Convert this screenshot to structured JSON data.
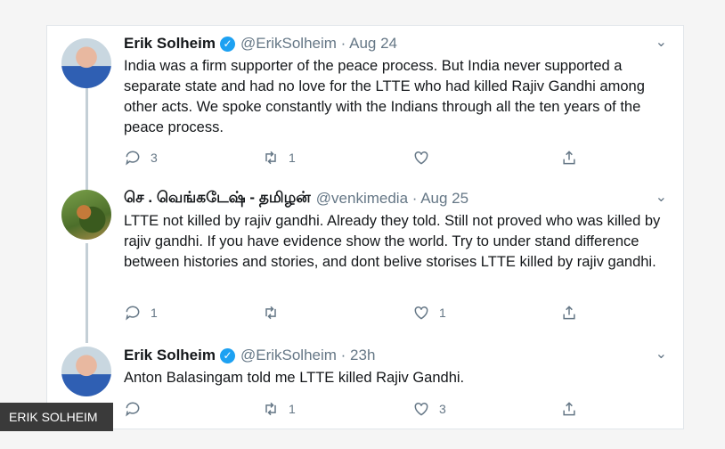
{
  "tweets": [
    {
      "name": "Erik Solheim",
      "handle": "@ErikSolheim · Aug 24",
      "text": "India was a firm supporter of the peace process. But India never supported a separate state and had no love for the LTTE who had killed Rajiv Gandhi among other acts. We spoke constantly with the Indians through all the ten years of the peace process.",
      "replies": "3",
      "retweets": "1",
      "likes": ""
    },
    {
      "name": "செ . வெங்கடேஷ் - தமிழன்",
      "handle": "@venkimedia · Aug 25",
      "text": "LTTE not killed by rajiv gandhi. Already they told. Still not proved who was killed by rajiv gandhi.  If you have evidence show the world. Try to under stand difference between histories and stories, and dont belive storises LTTE killed by rajiv gandhi.",
      "replies": "1",
      "retweets": "",
      "likes": "1"
    },
    {
      "name": "Erik Solheim",
      "handle": "@ErikSolheim · 23h",
      "text": "Anton Balasingam told me LTTE killed Rajiv Gandhi.",
      "replies": "",
      "retweets": "1",
      "likes": "3"
    }
  ],
  "credit": "ERIK SOLHEIM",
  "icons": [
    "verified-icon",
    "chevron-down-icon",
    "reply-icon",
    "retweet-icon",
    "like-icon",
    "share-icon"
  ],
  "colors": {
    "verified": "#1da1f2",
    "muted": "#657786",
    "thread_line": "#c4cfd6"
  }
}
